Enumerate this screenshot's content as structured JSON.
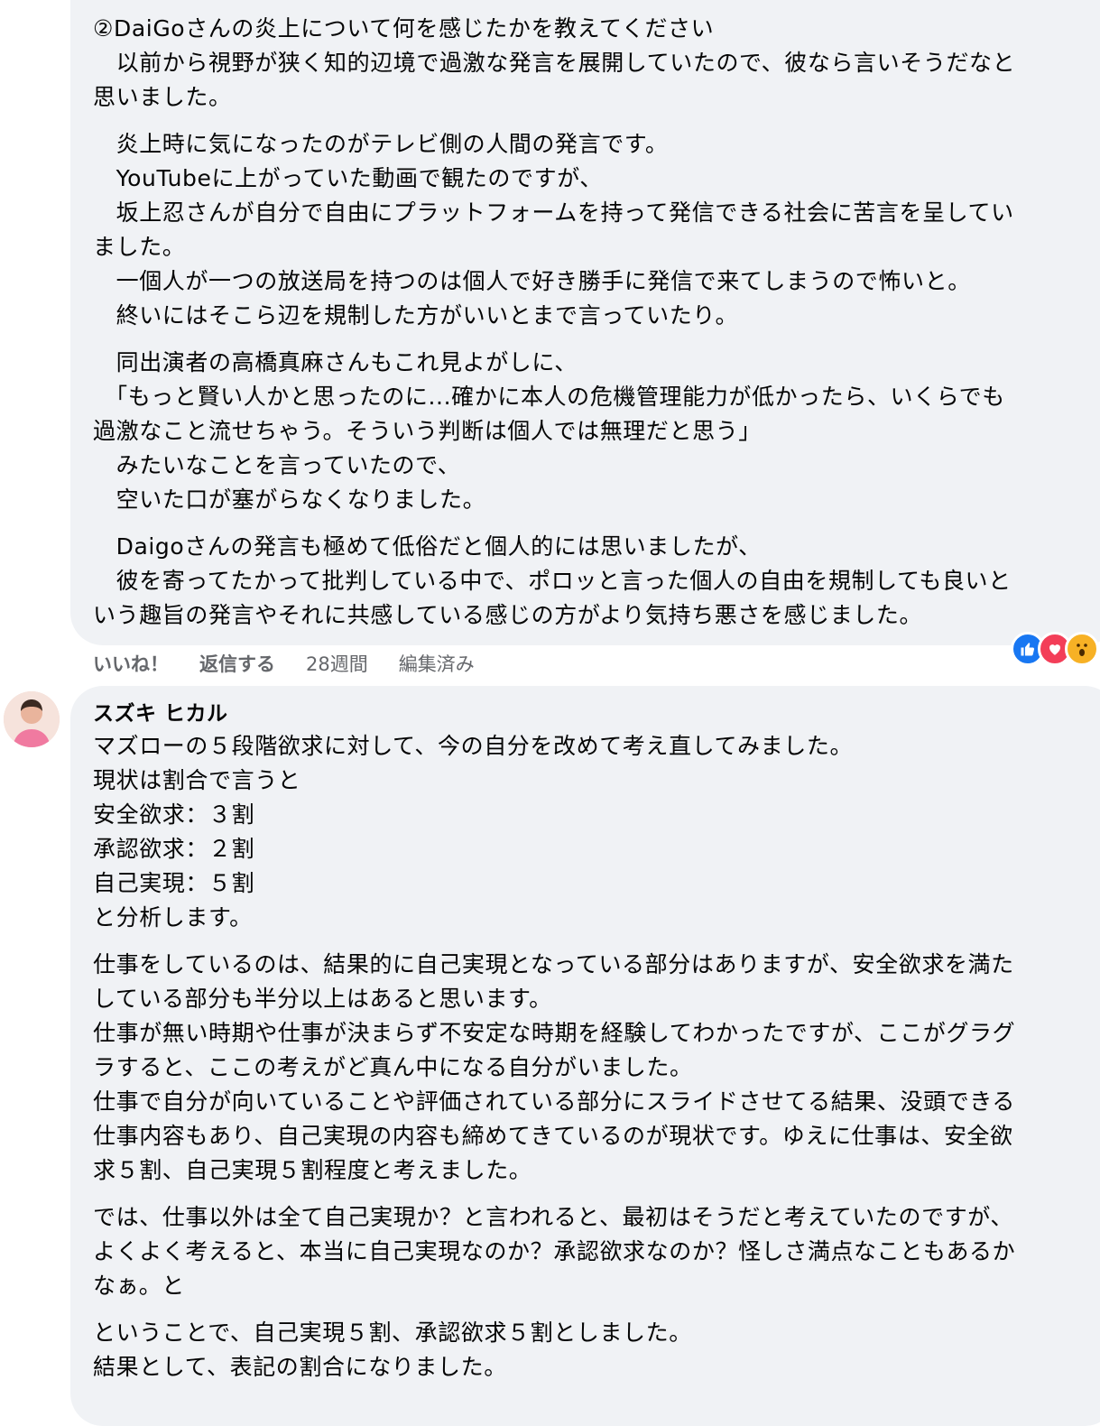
{
  "comment1": {
    "paragraphs": [
      [
        "②DaiGoさんの炎上について何を感じたかを教えてください",
        "　以前から視野が狭く知的辺境で過激な発言を展開していたので、彼なら言いそうだなと",
        "思いました。"
      ],
      [
        "　炎上時に気になったのがテレビ側の人間の発言です。",
        "　YouTubeに上がっていた動画で観たのですが、",
        "　坂上忍さんが自分で自由にプラットフォームを持って発信できる社会に苦言を呈してい",
        "ました。",
        "　一個人が一つの放送局を持つのは個人で好き勝手に発信で来てしまうので怖いと。",
        "　終いにはそこら辺を規制した方がいいとまで言っていたり。"
      ],
      [
        "　同出演者の高橋真麻さんもこれ見よがしに、",
        "　「もっと賢い人かと思ったのに...確かに本人の危機管理能力が低かったら、いくらでも",
        "過激なこと流せちゃう。そういう判断は個人では無理だと思う」",
        "　みたいなことを言っていたので、",
        "　空いた口が塞がらなくなりました。"
      ],
      [
        "　Daigoさんの発言も極めて低俗だと個人的には思いましたが、",
        "　彼を寄ってたかって批判している中で、ポロッと言った個人の自由を規制しても良いと",
        "いう趣旨の発言やそれに共感している感じの方がより気持ち悪さを感じました。"
      ]
    ],
    "actions": {
      "like": "いいね！",
      "reply": "返信する",
      "time": "28週間",
      "edited": "編集済み"
    },
    "reactions": [
      "like-icon",
      "love-icon",
      "wow-icon"
    ]
  },
  "comment2": {
    "author": "スズキ ヒカル",
    "paragraphs": [
      [
        "マズローの５段階欲求に対して、今の自分を改めて考え直してみました。",
        "現状は割合で言うと",
        "安全欲求：３割",
        "承認欲求：２割",
        "自己実現：５割",
        "と分析します。"
      ],
      [
        "仕事をしているのは、結果的に自己実現となっている部分はありますが、安全欲求を満た",
        "している部分も半分以上はあると思います。",
        "仕事が無い時期や仕事が決まらず不安定な時期を経験してわかったですが、ここがグラグ",
        "ラすると、ここの考えがど真ん中になる自分がいました。",
        "仕事で自分が向いていることや評価されている部分にスライドさせてる結果、没頭できる",
        "仕事内容もあり、自己実現の内容も締めてきているのが現状です。ゆえに仕事は、安全欲",
        "求５割、自己実現５割程度と考えました。"
      ],
      [
        "では、仕事以外は全て自己実現か？と言われると、最初はそうだと考えていたのですが、",
        "よくよく考えると、本当に自己実現なのか？承認欲求なのか？怪しさ満点なこともあるか",
        "なぁ。と"
      ],
      [
        "ということで、自己実現５割、承認欲求５割としました。",
        "結果として、表記の割合になりました。"
      ]
    ]
  }
}
